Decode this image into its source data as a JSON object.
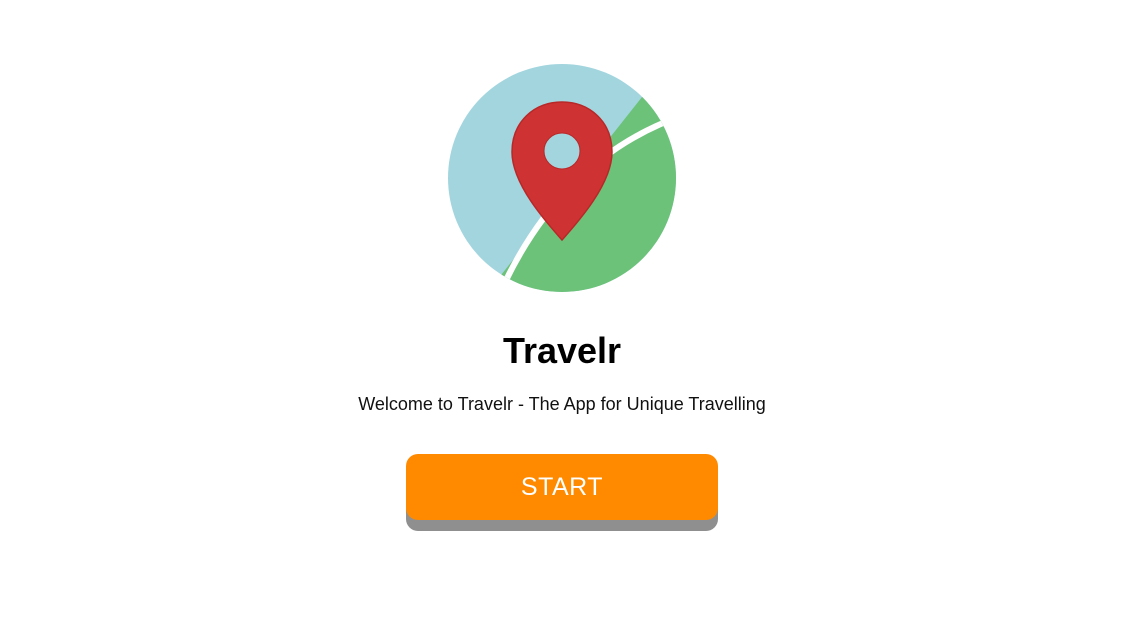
{
  "app": {
    "title": "Travelr",
    "tagline": "Welcome to Travelr - The App for Unique Travelling"
  },
  "logo": {
    "icon": "map-pin-icon",
    "colors": {
      "water": "#a3d5df",
      "land": "#6cc278",
      "road": "#ffffff",
      "pin": "#cf3232",
      "pin_hole": "#a3d5df"
    }
  },
  "actions": {
    "start_label": "START",
    "start_color": "#ff8a00",
    "start_shadow": "#8f8f8f"
  }
}
